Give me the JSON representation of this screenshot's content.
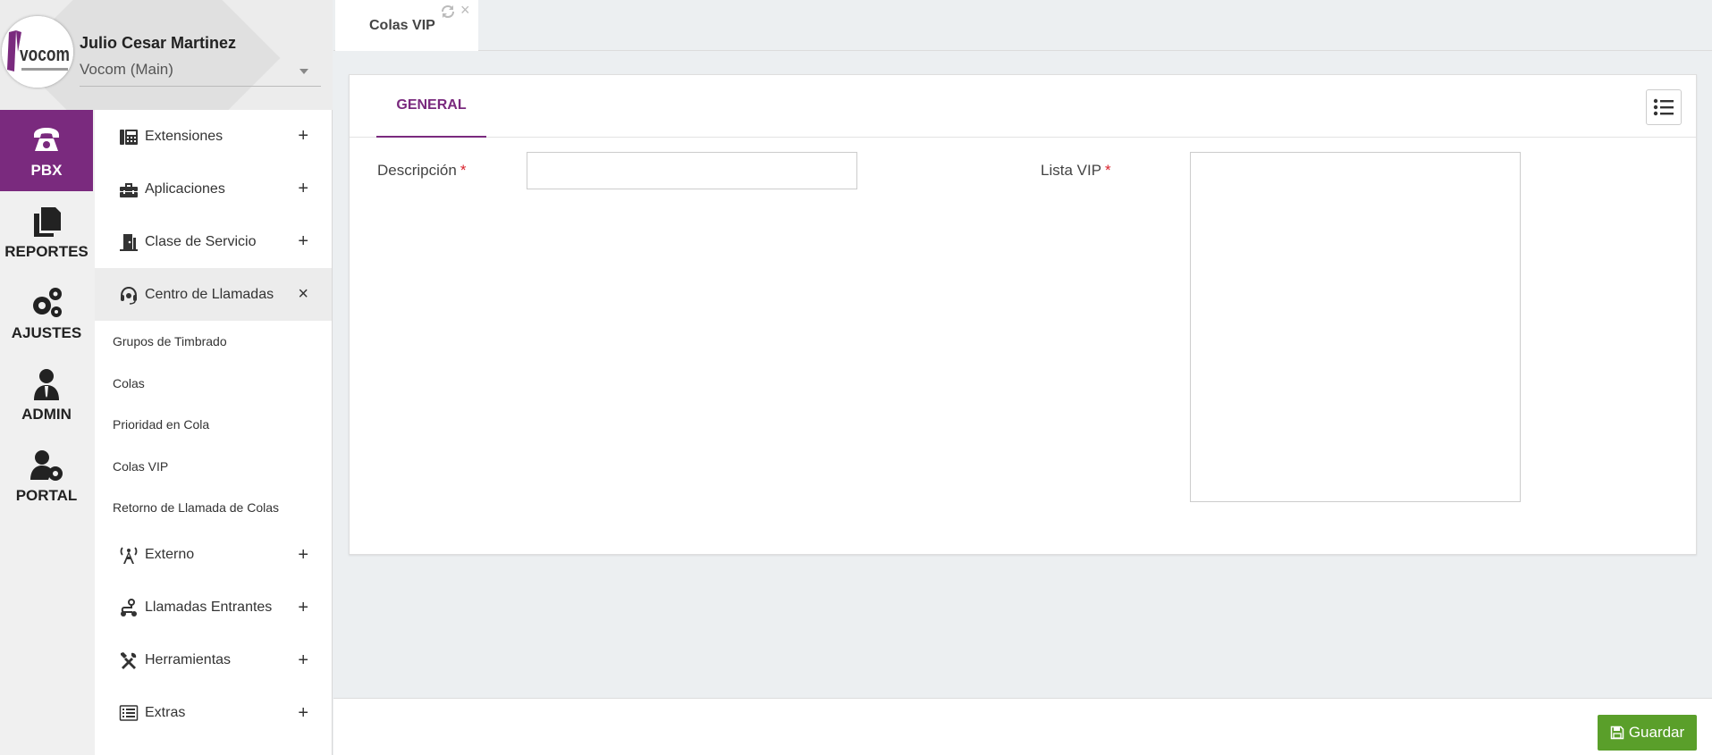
{
  "user": {
    "name": "Julio Cesar Martinez",
    "company": "Vocom (Main)"
  },
  "logo": {
    "text": "vocom",
    "brand_color": "#7a2a7e"
  },
  "modules": [
    {
      "label": "PBX",
      "icon": "phone-icon",
      "active": true
    },
    {
      "label": "REPORTES",
      "icon": "documents-icon",
      "active": false
    },
    {
      "label": "AJUSTES",
      "icon": "gears-icon",
      "active": false
    },
    {
      "label": "ADMIN",
      "icon": "user-tie-icon",
      "active": false
    },
    {
      "label": "PORTAL",
      "icon": "user-gear-icon",
      "active": false
    }
  ],
  "menu": {
    "items": [
      {
        "label": "Extensiones",
        "icon": "phone-office-icon",
        "toggle": "+"
      },
      {
        "label": "Aplicaciones",
        "icon": "toolbox-icon",
        "toggle": "+"
      },
      {
        "label": "Clase de Servicio",
        "icon": "door-icon",
        "toggle": "+"
      },
      {
        "label": "Centro de Llamadas",
        "icon": "headset-icon",
        "toggle": "×"
      },
      {
        "label": "Externo",
        "icon": "antenna-icon",
        "toggle": "+"
      },
      {
        "label": "Llamadas Entrantes",
        "icon": "route-icon",
        "toggle": "+"
      },
      {
        "label": "Herramientas",
        "icon": "tools-icon",
        "toggle": "+"
      },
      {
        "label": "Extras",
        "icon": "list-alt-icon",
        "toggle": "+"
      }
    ],
    "submenu": [
      "Grupos de Timbrado",
      "Colas",
      "Prioridad en Cola",
      "Colas VIP",
      "Retorno de Llamada de Colas"
    ]
  },
  "tab": {
    "label": "Colas VIP",
    "close": "×"
  },
  "form": {
    "tab_general": "GENERAL",
    "description_label": "Descripción",
    "vip_list_label": "Lista VIP",
    "required_mark": "*",
    "description_value": "",
    "vip_list_value": ""
  },
  "footer": {
    "save_label": "Guardar",
    "save_color": "#5a9f2a"
  },
  "colors": {
    "accent": "#7a2a7e",
    "required": "#d9232d"
  }
}
